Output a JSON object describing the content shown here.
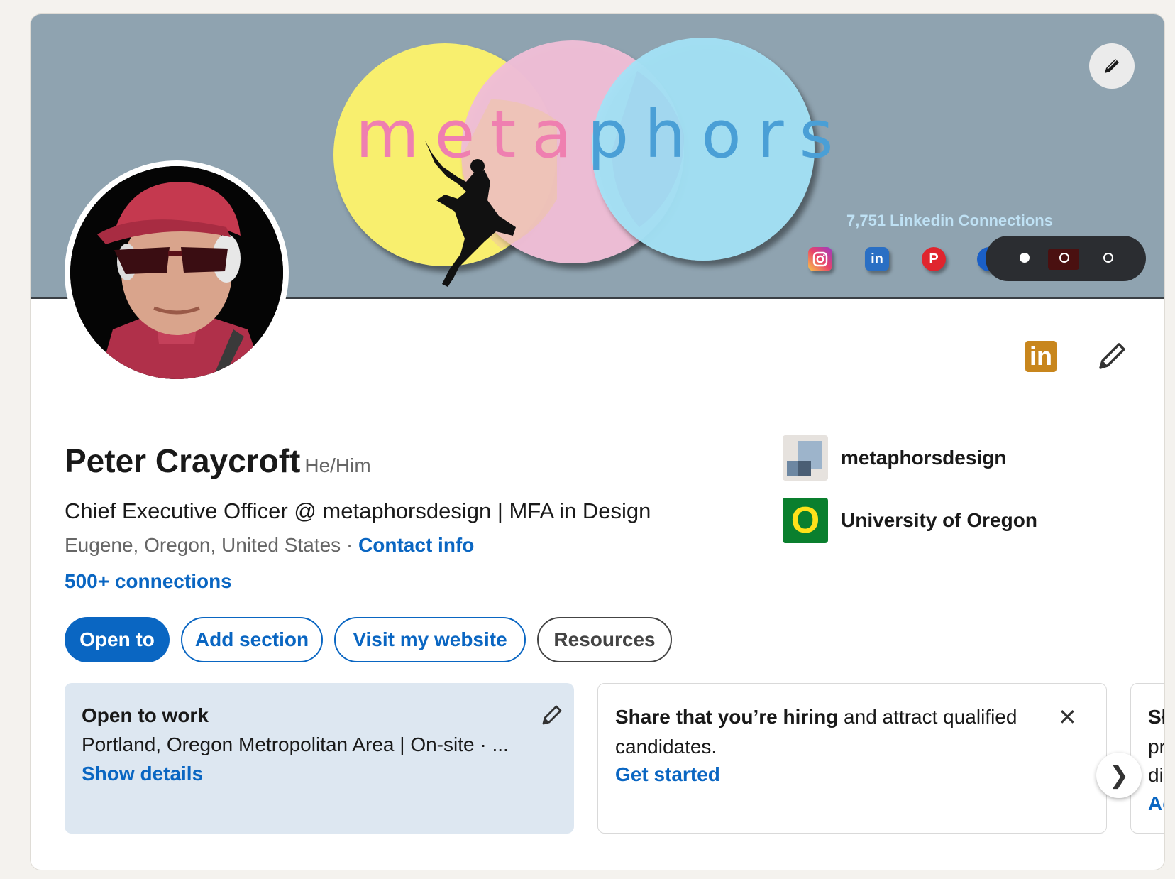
{
  "banner": {
    "logo_letters": [
      "m",
      "e",
      "t",
      "a",
      "p",
      "h",
      "o",
      "r",
      "s"
    ],
    "connections_text": "7,751 Linkedin Connections",
    "social_icons": [
      "instagram-icon",
      "linkedin-icon",
      "pinterest-icon",
      "facebook-icon"
    ],
    "linkedin_glyph": "in",
    "pinterest_glyph": "P",
    "carousel_dots": [
      "active",
      "inactive",
      "inactive"
    ]
  },
  "profile": {
    "name": "Peter Craycroft",
    "pronouns": "He/Him",
    "headline": "Chief Executive Officer @ metaphorsdesign | MFA in Design",
    "location": "Eugene, Oregon, United States",
    "separator": " · ",
    "contact_info": "Contact info",
    "connections": "500+ connections",
    "linkedin_badge": "in"
  },
  "actions": {
    "open_to": "Open to",
    "add_section": "Add section",
    "visit_website": "Visit my website",
    "resources": "Resources"
  },
  "organizations": [
    {
      "name": "metaphorsdesign"
    },
    {
      "name": "University of Oregon",
      "logo_letter": "O"
    }
  ],
  "cards": {
    "open_to_work": {
      "title": "Open to work",
      "details": "Portland, Oregon Metropolitan Area | On-site · ...",
      "link": "Show details"
    },
    "hiring": {
      "bold": "Share that you’re hiring",
      "rest": " and attract qualified",
      "line2": "candidates.",
      "link": "Get started",
      "close": "✕"
    },
    "third": {
      "lines": [
        "Sł",
        "pr",
        "di",
        "Ac"
      ]
    },
    "next": "❯"
  },
  "colors": {
    "brand_blue": "#0a66c2",
    "banner_bg": "#8fa3b0",
    "linkedin_badge": "#c8861d",
    "oregon_green": "#0a7f2e",
    "oregon_yellow": "#fee11a"
  }
}
